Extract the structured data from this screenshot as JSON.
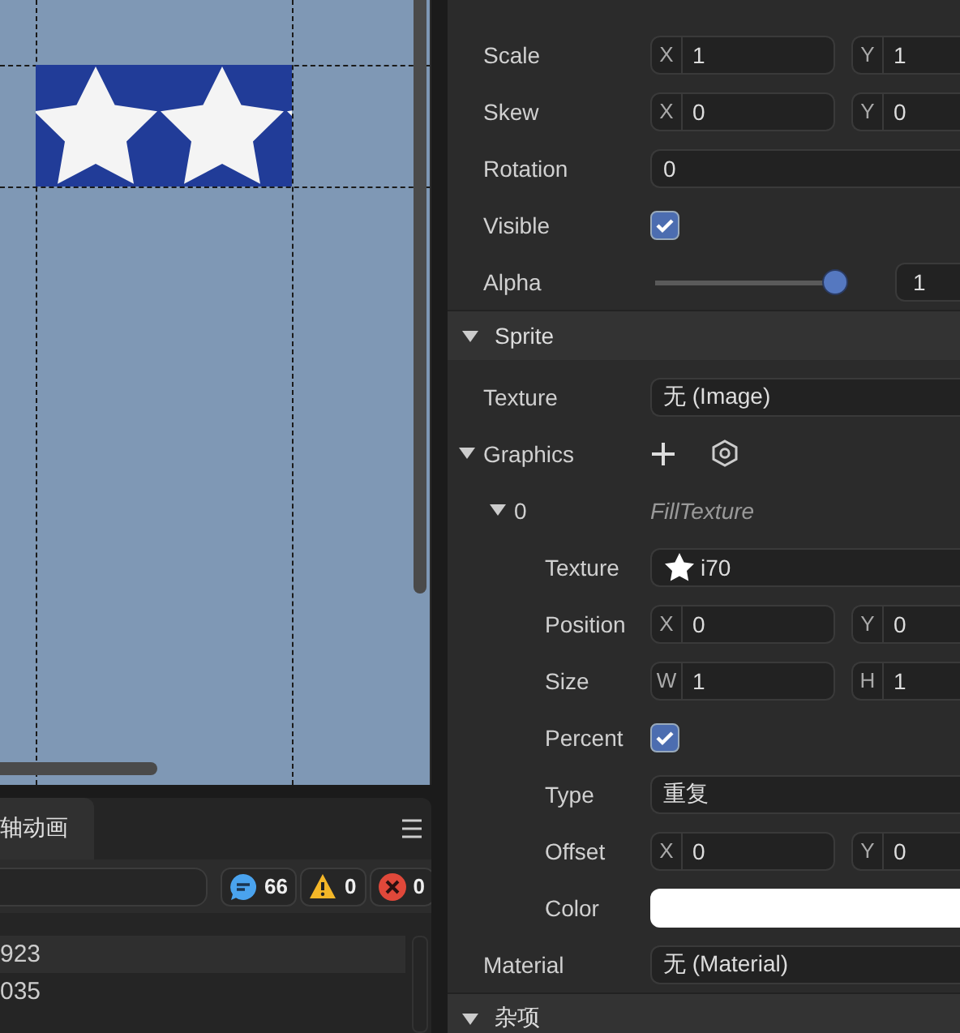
{
  "timeline_panel": {
    "tabs": [
      {
        "label": "轴动画",
        "selected": true
      }
    ],
    "counters": [
      {
        "kind": "info",
        "count": "66"
      },
      {
        "kind": "warning",
        "count": "0"
      },
      {
        "kind": "error",
        "count": "0"
      }
    ],
    "log_rows": [
      {
        "text": "923"
      },
      {
        "text": "035"
      }
    ]
  },
  "inspector": {
    "sections": [
      {
        "rows": [
          {
            "kind": "vector",
            "label": "Scale",
            "fields": [
              {
                "axis": "X",
                "value": "1"
              },
              {
                "axis": "Y",
                "value": "1"
              }
            ]
          },
          {
            "kind": "vector",
            "label": "Skew",
            "fields": [
              {
                "axis": "X",
                "value": "0"
              },
              {
                "axis": "Y",
                "value": "0"
              }
            ]
          },
          {
            "kind": "text",
            "label": "Rotation",
            "value": "0"
          },
          {
            "kind": "checkbox",
            "label": "Visible",
            "checked": true
          },
          {
            "kind": "slider",
            "label": "Alpha",
            "level": 1,
            "reading": "1"
          }
        ]
      },
      {
        "title": "Sprite",
        "expanded": true,
        "rows": [
          {
            "kind": "text",
            "label": "Texture",
            "value": "无 (Image)"
          },
          {
            "kind": "group",
            "label": "Graphics",
            "expanded": true,
            "children": [
              {
                "kind": "group",
                "label": "0",
                "expanded": true,
                "type_label": "FillTexture",
                "children": [
                  {
                    "kind": "texture",
                    "label": "Texture",
                    "value": "i70"
                  },
                  {
                    "kind": "vector",
                    "label": "Position",
                    "fields": [
                      {
                        "axis": "X",
                        "value": "0"
                      },
                      {
                        "axis": "Y",
                        "value": "0"
                      }
                    ]
                  },
                  {
                    "kind": "vector",
                    "label": "Size",
                    "fields": [
                      {
                        "axis": "W",
                        "value": "1"
                      },
                      {
                        "axis": "H",
                        "value": "1"
                      }
                    ]
                  },
                  {
                    "kind": "checkbox",
                    "label": "Percent",
                    "checked": true
                  },
                  {
                    "kind": "text",
                    "label": "Type",
                    "value": "重复"
                  },
                  {
                    "kind": "vector",
                    "label": "Offset",
                    "fields": [
                      {
                        "axis": "X",
                        "value": "0"
                      },
                      {
                        "axis": "Y",
                        "value": "0"
                      }
                    ]
                  },
                  {
                    "kind": "color",
                    "label": "Color",
                    "color": "#ffffff"
                  }
                ]
              }
            ]
          },
          {
            "kind": "text",
            "label": "Material",
            "value": "无 (Material)"
          }
        ]
      },
      {
        "title": "杂项",
        "expanded": true
      }
    ]
  }
}
